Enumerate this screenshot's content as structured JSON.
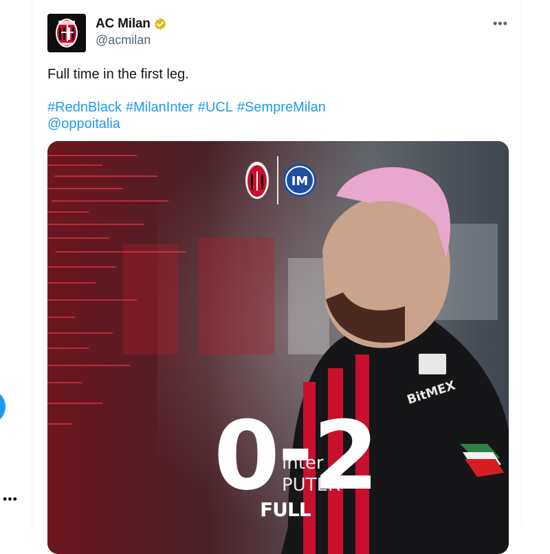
{
  "tweet": {
    "author": {
      "name": "AC Milan",
      "handle": "@acmilan",
      "avatar_icon": "ac-milan-crest-icon",
      "verified_icon": "verified-badge-icon",
      "verified_color": "#e2b719"
    },
    "more_label": "•••",
    "text": "Full time in the first leg.",
    "hashtags": [
      "#RednBlack",
      "#MilanInter",
      "#UCL",
      "#SempreMilan"
    ],
    "mention": "@oppoitalia",
    "media": {
      "team_logos": [
        "ac-milan-crest-icon",
        "inter-crest-icon"
      ],
      "score_home": "0",
      "score_away": "2",
      "score_separator": "-",
      "caption": "FULL",
      "sponsor": "BitMEX",
      "shirt_lettering": "inter",
      "shirt_lettering_2": "PUTER"
    }
  },
  "sidebar": {
    "more_label": "•••"
  },
  "colors": {
    "link": "#1d9bf0",
    "secondary_text": "#536471",
    "milan_red": "#d71d24",
    "inter_blue": "#1e4fa3"
  }
}
